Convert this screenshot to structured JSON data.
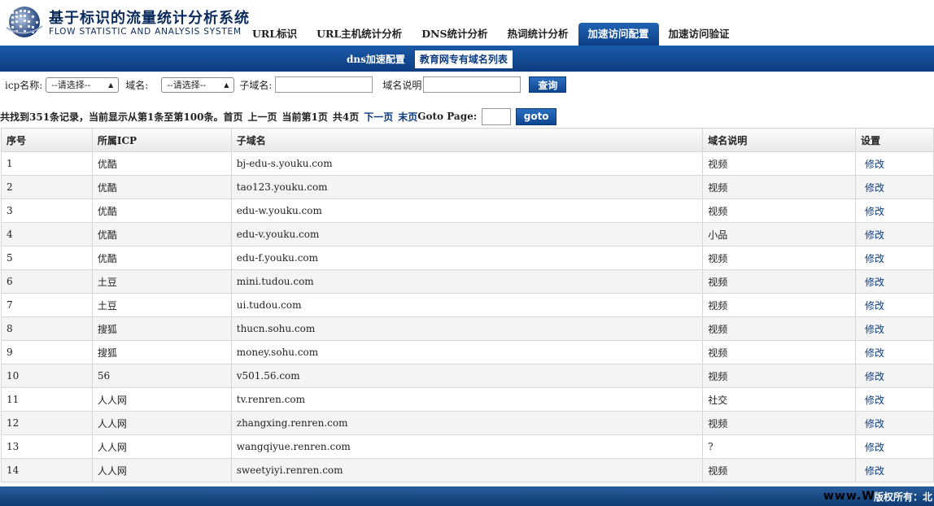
{
  "header": {
    "title_cn": "基于标识的流量统计分析系统",
    "title_en": "FLOW STATISTIC AND ANALYSIS SYSTEM"
  },
  "nav": {
    "tabs": [
      {
        "label": "URL标识",
        "active": false
      },
      {
        "label": "URL主机统计分析",
        "active": false
      },
      {
        "label": "DNS统计分析",
        "active": false
      },
      {
        "label": "热词统计分析",
        "active": false
      },
      {
        "label": "加速访问配置",
        "active": true
      },
      {
        "label": "加速访问验证",
        "active": false
      }
    ]
  },
  "subnav": {
    "tabs": [
      {
        "label": "dns加速配置",
        "active": false
      },
      {
        "label": "教育网专有域名列表",
        "active": true
      }
    ]
  },
  "filters": {
    "icp_label": "icp名称:",
    "icp_value": "--请选择--",
    "domain_label": "域名:",
    "domain_value": "--请选择--",
    "subdomain_label": "子域名:",
    "subdomain_value": "",
    "desc_label": "域名说明",
    "desc_value": "",
    "query_label": "查询"
  },
  "pager": {
    "summary": "共找到351条记录，当前显示从第1条至第100条。",
    "first": "首页",
    "prev": "上一页",
    "current": "当前第1页",
    "total": "共4页",
    "next": "下一页",
    "last": "末页",
    "goto_label": "Goto Page:",
    "goto_value": "",
    "goto_button": "goto"
  },
  "table": {
    "headers": [
      "序号",
      "所属ICP",
      "子域名",
      "域名说明",
      "设置"
    ],
    "rows": [
      [
        "1",
        "优酷",
        "bj-edu-s.youku.com",
        "视频",
        "修改"
      ],
      [
        "2",
        "优酷",
        "tao123.youku.com",
        "视频",
        "修改"
      ],
      [
        "3",
        "优酷",
        "edu-w.youku.com",
        "视频",
        "修改"
      ],
      [
        "4",
        "优酷",
        "edu-v.youku.com",
        "小品",
        "修改"
      ],
      [
        "5",
        "优酷",
        "edu-f.youku.com",
        "视频",
        "修改"
      ],
      [
        "6",
        "土豆",
        "mini.tudou.com",
        "视频",
        "修改"
      ],
      [
        "7",
        "土豆",
        "ui.tudou.com",
        "视频",
        "修改"
      ],
      [
        "8",
        "搜狐",
        "thucn.sohu.com",
        "视频",
        "修改"
      ],
      [
        "9",
        "搜狐",
        "money.sohu.com",
        "视频",
        "修改"
      ],
      [
        "10",
        "56",
        "v501.56.com",
        "视频",
        "修改"
      ],
      [
        "11",
        "人人网",
        "tv.renren.com",
        "社交",
        "修改"
      ],
      [
        "12",
        "人人网",
        "zhangxing.renren.com",
        "视频",
        "修改"
      ],
      [
        "13",
        "人人网",
        "wangqiyue.renren.com",
        "?",
        "修改"
      ],
      [
        "14",
        "人人网",
        "sweetyiyi.renren.com",
        "视频",
        "修改"
      ]
    ]
  },
  "footer": {
    "text": "版权所有：北",
    "watermark": "www.W"
  },
  "colors": {
    "primary_blue": "#0d3c80",
    "active_tab": "#1f64b4"
  }
}
